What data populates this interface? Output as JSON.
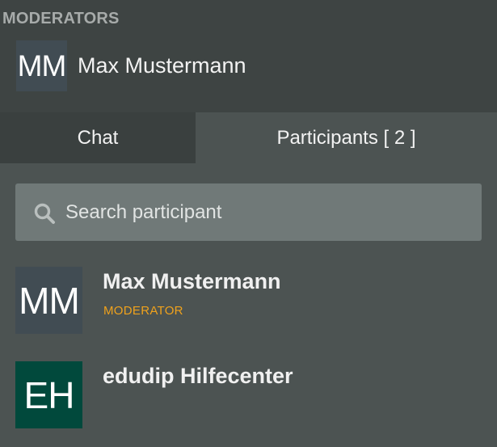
{
  "moderators": {
    "heading": "MODERATORS",
    "items": [
      {
        "initials": "MM",
        "name": "Max Mustermann"
      }
    ]
  },
  "tabs": [
    {
      "label": "Chat",
      "active": false
    },
    {
      "label": "Participants [ 2 ]",
      "active": true
    }
  ],
  "search": {
    "placeholder": "Search participant",
    "value": "",
    "icon": "search-icon"
  },
  "participants": [
    {
      "initials": "MM",
      "name": "Max Mustermann",
      "role": "MODERATOR",
      "avatar_color": "#414c53"
    },
    {
      "initials": "EH",
      "name": "edudip Hilfecenter",
      "role": "",
      "avatar_color": "#01493c"
    }
  ],
  "colors": {
    "background": "#4c5352",
    "header_background": "#3e4443",
    "inactive_tab": "#3a403f",
    "search_field": "#707978",
    "role_accent": "#f0a21c"
  }
}
